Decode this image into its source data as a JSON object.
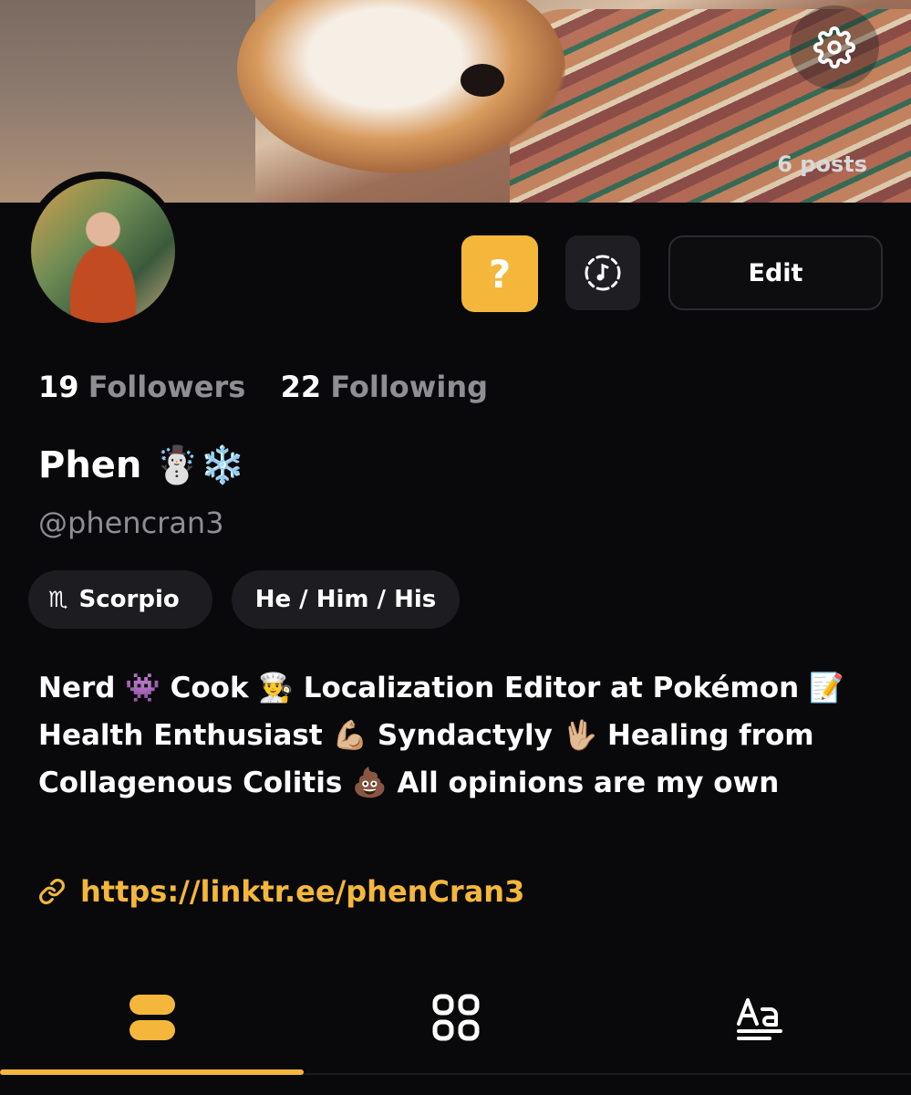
{
  "header": {
    "posts_count": "6 posts"
  },
  "actions": {
    "help_label": "?",
    "edit_label": "Edit"
  },
  "stats": {
    "followers_count": "19",
    "followers_label": "Followers",
    "following_count": "22",
    "following_label": "Following"
  },
  "profile": {
    "name": "Phen ☃️❄️",
    "handle": "@phencran3",
    "zodiac_symbol": "♏",
    "zodiac": "Scorpio",
    "pronouns": "He / Him / His",
    "bio": "Nerd 👾  Cook 👨‍🍳  Localization Editor at Pokémon 📝  Health Enthusiast 💪🏼  Syndactyly 🖖🏼  Healing from Collagenous Colitis 💩  All opinions are my own",
    "link": "https://linktr.ee/phenCran3"
  },
  "tabs": [
    {
      "name": "posts",
      "icon": "stacked-cards-icon",
      "active": true
    },
    {
      "name": "grid",
      "icon": "grid-icon",
      "active": false
    },
    {
      "name": "text",
      "icon": "text-aa-icon",
      "active": false
    }
  ],
  "colors": {
    "accent": "#f5b73b",
    "background": "#09090b",
    "muted": "#8e8e93",
    "chip": "#1d1d21"
  }
}
